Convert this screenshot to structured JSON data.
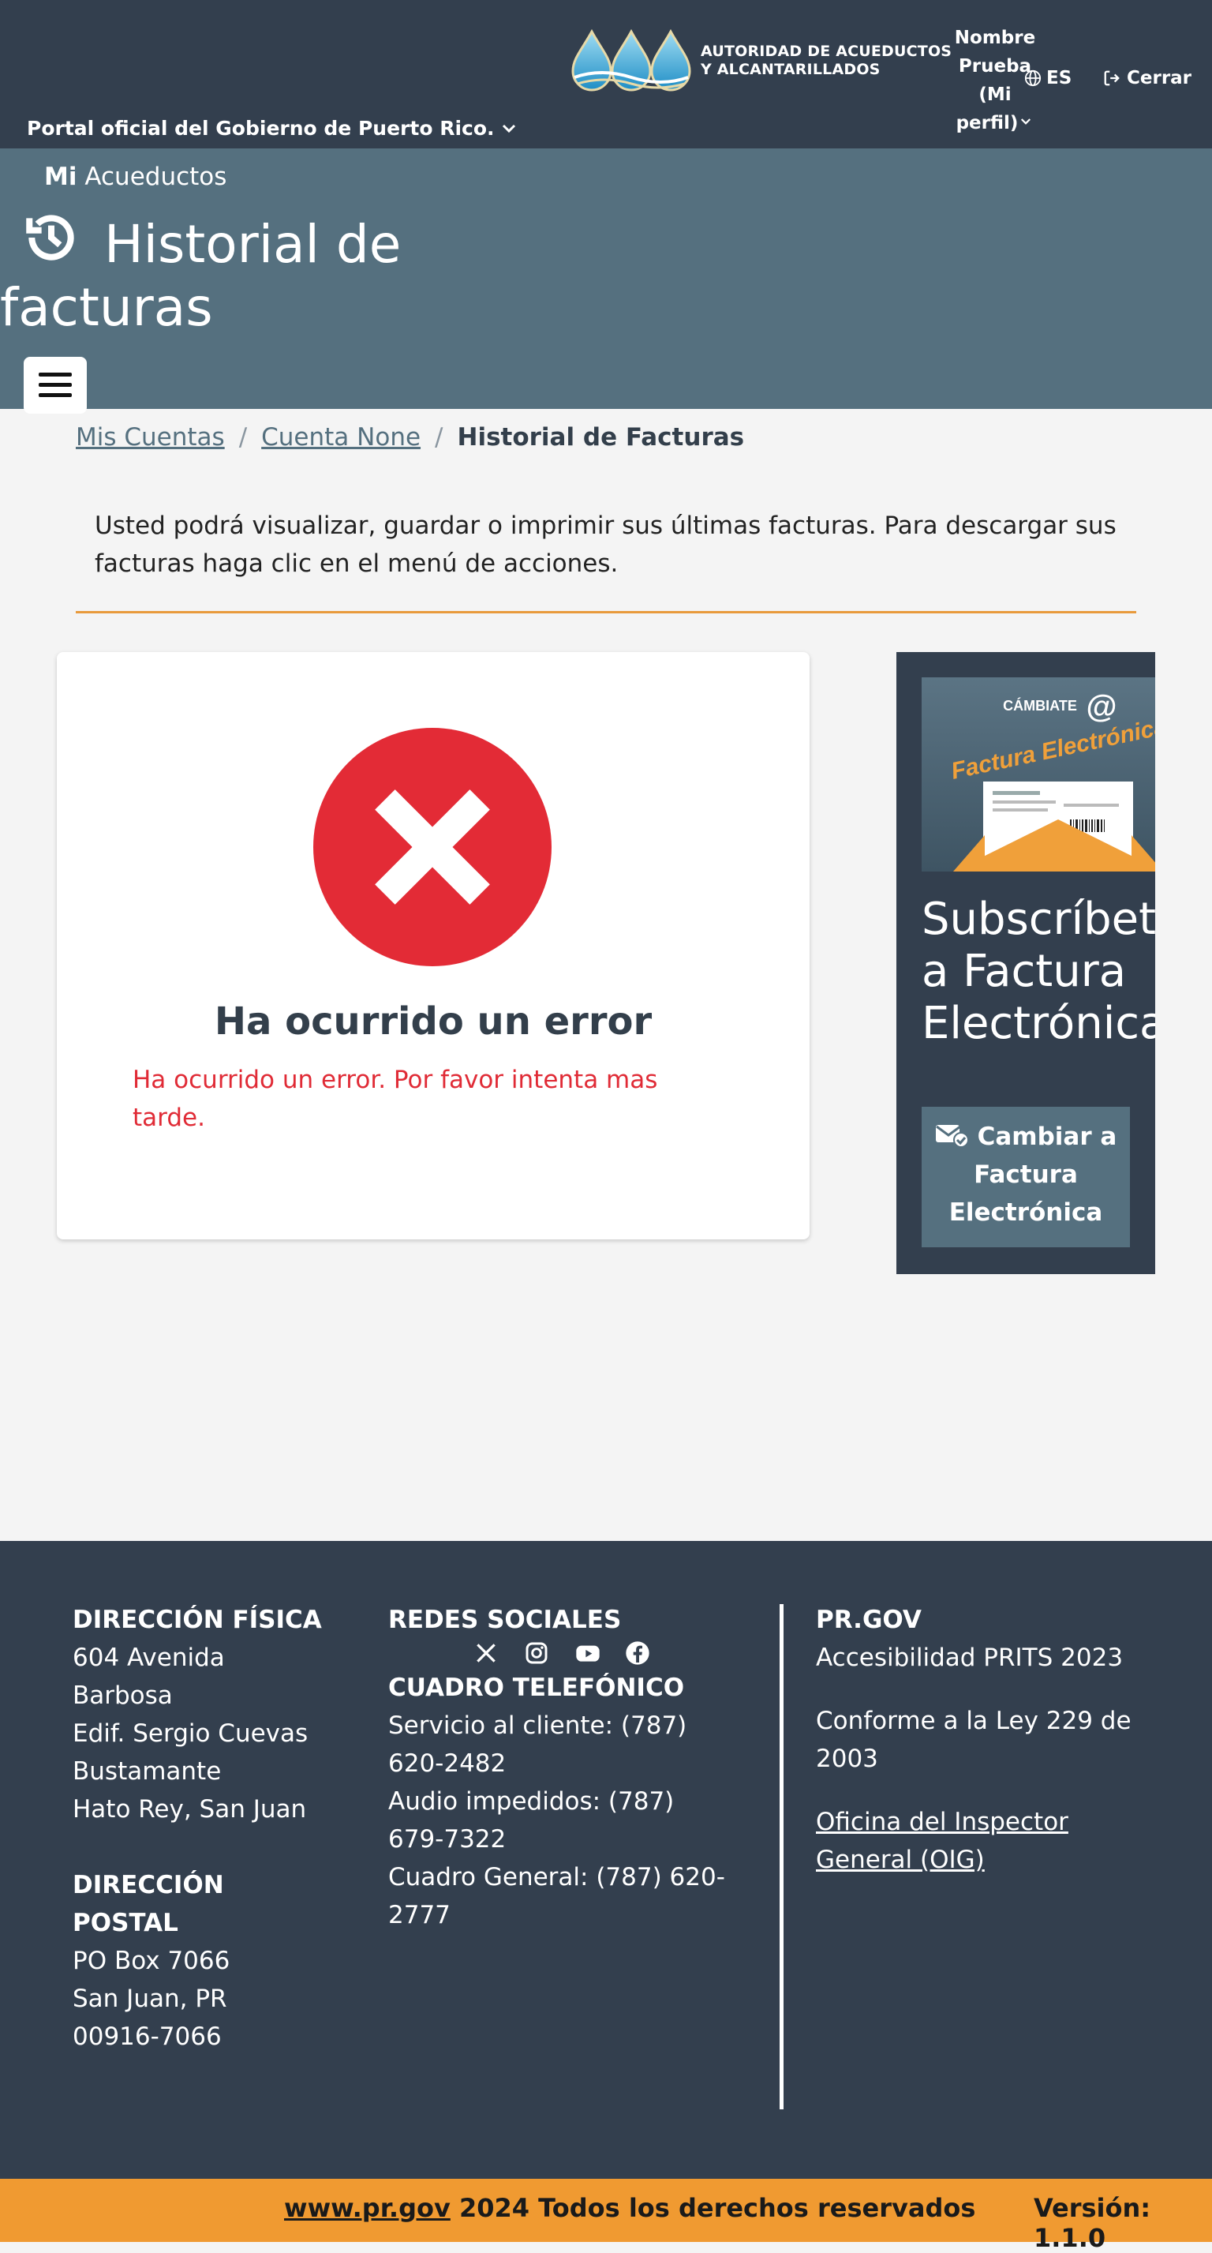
{
  "topbar": {
    "gov_link": "Portal oficial del Gobierno de Puerto Rico.",
    "logo_line1": "AUTORIDAD DE ACUEDUCTOS",
    "logo_line2": "Y ALCANTARILLADOS",
    "profile_lines": [
      "Nombre",
      "Prueba",
      "(Mi",
      "perfil)"
    ],
    "language": "ES",
    "logout": "Cerrar"
  },
  "hero": {
    "app_name_bold": "Mi",
    "app_name": "Acueductos",
    "title": "Historial de facturas"
  },
  "breadcrumb": {
    "items": [
      "Mis Cuentas",
      "Cuenta None"
    ],
    "current": "Historial de Facturas",
    "separator": "/"
  },
  "intro": "Usted podrá visualizar, guardar o imprimir sus últimas facturas. Para descargar sus facturas haga clic en el menú de acciones.",
  "error": {
    "title": "Ha ocurrido un error",
    "message": "Ha ocurrido un error. Por favor intenta mas tarde."
  },
  "promo": {
    "image_top": "CÁMBIATE",
    "image_brand": "Factura Electrónica",
    "title": "Subscríbete a Factura Electrónica",
    "button": "Cambiar a Factura Electrónica"
  },
  "footer": {
    "address_heading": "DIRECCIÓN FÍSICA",
    "address_lines": [
      "604 Avenida",
      "Barbosa",
      "Edif. Sergio Cuevas",
      "Bustamante",
      "Hato Rey, San Juan"
    ],
    "postal_heading_lines": [
      "DIRECCIÓN",
      "POSTAL"
    ],
    "postal_lines": [
      "PO Box 7066",
      "San Juan, PR",
      "00916-7066"
    ],
    "social_heading": "REDES SOCIALES",
    "social_icons": [
      "x-icon",
      "instagram-icon",
      "youtube-icon",
      "facebook-icon"
    ],
    "phone_heading": "CUADRO TELEFÓNICO",
    "phone_lines": [
      "Servicio al cliente: (787)",
      "620-2482",
      "Audio impedidos: (787)",
      "679-7322",
      "Cuadro General: (787) 620-",
      "2777"
    ],
    "prgov_heading": "PR.GOV",
    "accessibility": "Accesibilidad PRITS 2023",
    "law_lines": [
      "Conforme a la Ley 229 de",
      "2003"
    ],
    "oig_lines": [
      "Oficina del Inspector",
      "General (OIG)"
    ]
  },
  "bottombar": {
    "link": "www.pr.gov",
    "copyright": "2024 Todos los derechos reservados",
    "version": "Versión: 1.1.0"
  },
  "colors": {
    "dark": "#333f4e",
    "hero": "#55707f",
    "accent": "#f09a31",
    "error": "#e32b36"
  }
}
